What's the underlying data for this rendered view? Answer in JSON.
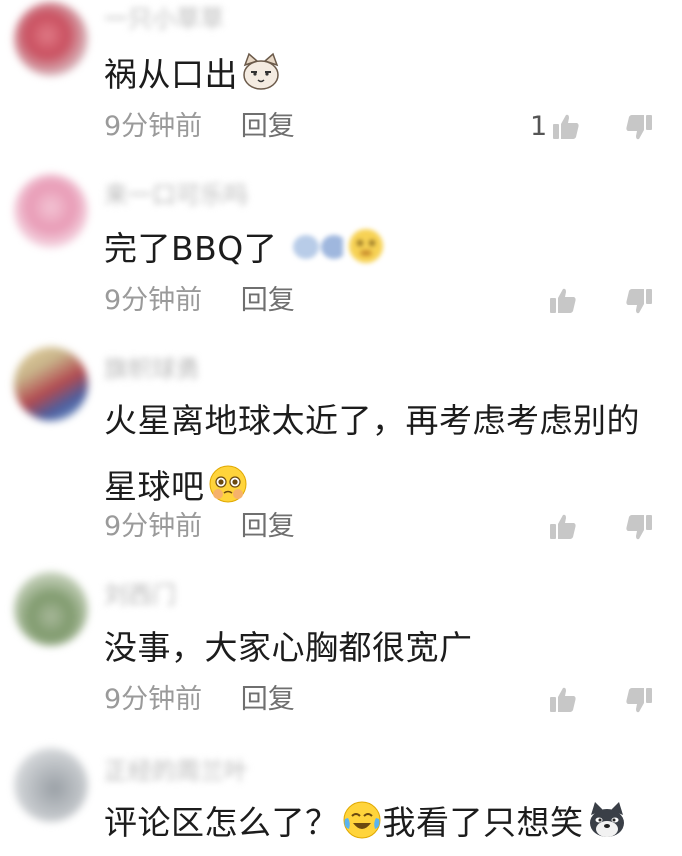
{
  "colors": {
    "background": "#ffffff",
    "username": "#b9b9b9",
    "comment_text": "#1c1c1c",
    "meta_text": "#9a9a9a",
    "icon": "#c7c7c7"
  },
  "comments": [
    {
      "username": "一只小草草",
      "line1": "祸从口出",
      "line2": "",
      "time": "9分钟前",
      "reply": "回复",
      "likes": "1"
    },
    {
      "username": "来一口可乐吗",
      "line1": "完了BBQ了",
      "line2": "",
      "time": "9分钟前",
      "reply": "回复",
      "likes": ""
    },
    {
      "username": "旗帜球勇",
      "line1": "火星离地球太近了，再考虑考虑别的",
      "line2": "星球吧",
      "time": "9分钟前",
      "reply": "回复",
      "likes": ""
    },
    {
      "username": "刘西门",
      "line1": "没事，大家心胸都很宽广",
      "line2": "",
      "time": "9分钟前",
      "reply": "回复",
      "likes": ""
    },
    {
      "username": "正经的周兰叶",
      "line1": "评论区怎么了？",
      "line1b": "我看了只想笑",
      "line2": "",
      "time": "",
      "reply": "",
      "likes": ""
    }
  ],
  "icons": {
    "like": "thumbs-up-icon",
    "dislike": "thumbs-down-icon",
    "emojis": [
      "cat-face-icon",
      "blurred-emoji-icon",
      "sun-emoji-icon",
      "pleading-face-icon",
      "tears-of-joy-icon",
      "doge-icon"
    ]
  }
}
